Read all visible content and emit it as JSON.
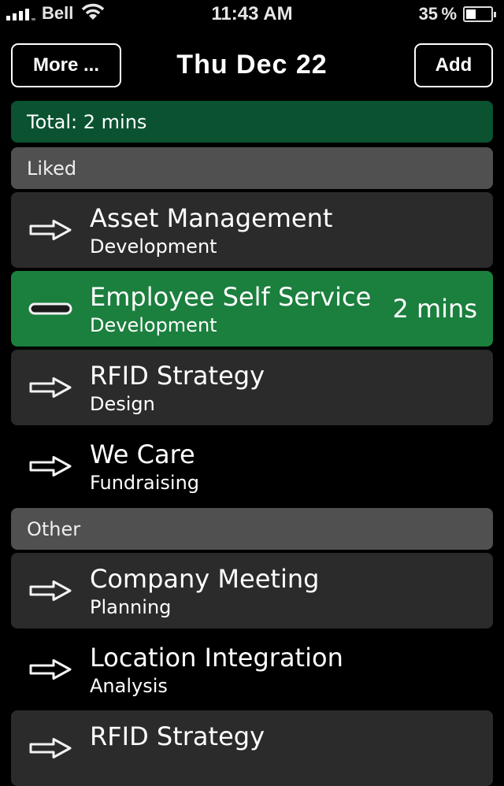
{
  "status_bar": {
    "carrier": "Bell",
    "time": "11:43 AM",
    "battery_percent": "35 %",
    "battery_level": 0.35
  },
  "nav": {
    "more_label": "More ...",
    "title": "Thu Dec 22",
    "add_label": "Add"
  },
  "total_label": "Total: 2 mins",
  "sections": [
    {
      "title": "Liked",
      "items": [
        {
          "name": "Asset Management",
          "category": "Development",
          "duration": "",
          "state": "idle",
          "style": "dark",
          "icon": "arrow-right-icon"
        },
        {
          "name": "Employee Self Service",
          "category": "Development",
          "duration": "2 mins",
          "state": "running",
          "style": "active",
          "icon": "minus-icon"
        },
        {
          "name": "RFID Strategy",
          "category": "Design",
          "duration": "",
          "state": "idle",
          "style": "dark",
          "icon": "arrow-right-icon"
        },
        {
          "name": "We Care",
          "category": "Fundraising",
          "duration": "",
          "state": "idle",
          "style": "plain",
          "icon": "arrow-right-icon"
        }
      ]
    },
    {
      "title": "Other",
      "items": [
        {
          "name": "Company Meeting",
          "category": "Planning",
          "duration": "",
          "state": "idle",
          "style": "dark",
          "icon": "arrow-right-icon"
        },
        {
          "name": "Location Integration",
          "category": "Analysis",
          "duration": "",
          "state": "idle",
          "style": "plain",
          "icon": "arrow-right-icon"
        },
        {
          "name": "RFID Strategy",
          "category": "",
          "duration": "",
          "state": "idle",
          "style": "dark",
          "icon": "arrow-right-icon"
        }
      ]
    }
  ],
  "colors": {
    "total_bg": "#0b5230",
    "active_item_bg": "#1b7f3e",
    "item_bg": "#2b2b2b",
    "section_bg": "#505050"
  }
}
